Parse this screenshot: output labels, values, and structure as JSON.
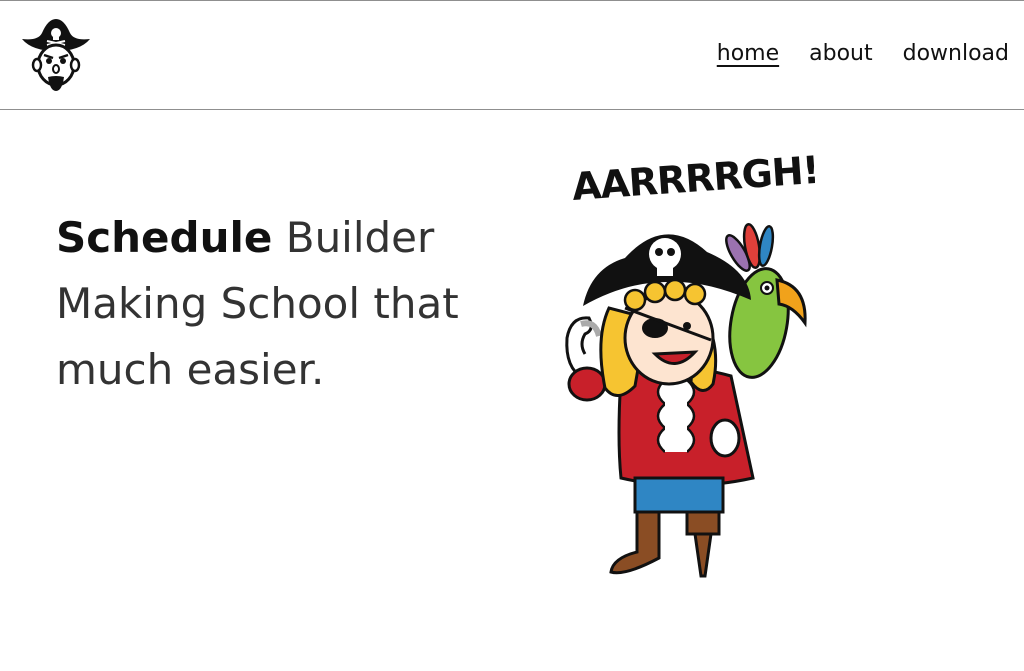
{
  "header": {
    "logo_icon": "pirate-head-icon",
    "nav": [
      {
        "label": "home",
        "active": true
      },
      {
        "label": "about",
        "active": false
      },
      {
        "label": "download",
        "active": false
      }
    ]
  },
  "hero": {
    "title_bold": "Schedule",
    "title_rest": "Builder",
    "line2": "Making School that",
    "line3": "much easier."
  },
  "illustration": {
    "shout": "AARRRRGH!",
    "icon": "pirate-with-parrot-illustration"
  },
  "colors": {
    "coat": "#c8202a",
    "hat": "#111111",
    "hair": "#f6c431",
    "parrot": "#86c540",
    "beak": "#f1a21b",
    "pants": "#2f86c4",
    "boot": "#8a4d24"
  }
}
